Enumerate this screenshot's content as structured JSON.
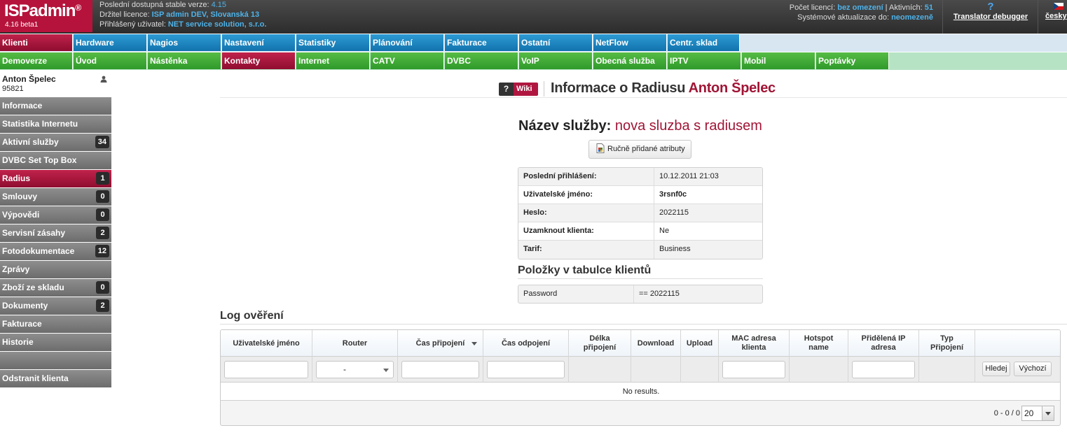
{
  "app": {
    "logo": "ISPadmin",
    "logo_reg": "®",
    "version": "4.16 beta1"
  },
  "topinfo": {
    "stable_label": "Poslední dostupná stable verze:",
    "stable_value": "4.15",
    "holder_label": "Držitel licence:",
    "holder_value": "ISP admin DEV, Slovanská 13",
    "user_label": "Přihlášený uživatel:",
    "user_value": "NET service solution, s.r.o."
  },
  "license": {
    "count_label": "Počet licencí:",
    "count_value": "bez omezení",
    "active_label": "Aktivních:",
    "active_value": "51",
    "updates_label": "Systémové aktualizace do:",
    "updates_value": "neomezeně"
  },
  "debugger": {
    "icon": "?",
    "label": "Translator debugger"
  },
  "language": {
    "label": "česky"
  },
  "menu1": [
    {
      "label": "Klienti",
      "active": true
    },
    {
      "label": "Hardware"
    },
    {
      "label": "Nagios"
    },
    {
      "label": "Nastavení"
    },
    {
      "label": "Statistiky"
    },
    {
      "label": "Plánování"
    },
    {
      "label": "Fakturace"
    },
    {
      "label": "Ostatní"
    },
    {
      "label": "NetFlow"
    },
    {
      "label": "Centr. sklad"
    }
  ],
  "menu2": [
    {
      "label": "Demoverze"
    },
    {
      "label": "Úvod"
    },
    {
      "label": "Nástěnka"
    },
    {
      "label": "Kontakty",
      "active": true
    },
    {
      "label": "Internet"
    },
    {
      "label": "CATV"
    },
    {
      "label": "DVBC"
    },
    {
      "label": "VoIP"
    },
    {
      "label": "Obecná služba"
    },
    {
      "label": "IPTV"
    },
    {
      "label": "Mobil"
    },
    {
      "label": "Poptávky"
    }
  ],
  "client": {
    "name": "Anton Špelec",
    "id": "95821"
  },
  "sidebar": [
    {
      "label": "Informace"
    },
    {
      "label": "Statistika Internetu"
    },
    {
      "label": "Aktivní služby",
      "badge": "34"
    },
    {
      "label": "DVBC Set Top Box"
    },
    {
      "label": "Radius",
      "badge": "1",
      "active": true
    },
    {
      "label": "Smlouvy",
      "badge": "0"
    },
    {
      "label": "Výpovědi",
      "badge": "0"
    },
    {
      "label": "Servisní zásahy",
      "badge": "2"
    },
    {
      "label": "Fotodokumentace",
      "badge": "12"
    },
    {
      "label": "Zprávy"
    },
    {
      "label": "Zboží ze skladu",
      "badge": "0"
    },
    {
      "label": "Dokumenty",
      "badge": "2"
    },
    {
      "label": "Fakturace"
    },
    {
      "label": "Historie"
    },
    {
      "label": ""
    },
    {
      "label": "Odstranit klienta"
    }
  ],
  "page": {
    "wiki_q": "?",
    "wiki_label": "Wiki",
    "title_prefix": "Informace o Radiusu",
    "title_client": "Anton Špelec",
    "service_label": "Název služby:",
    "service_value": "nova sluzba s radiusem",
    "attr_button": "Ručně přidané atributy"
  },
  "details": [
    {
      "key": "Poslední přihlášení:",
      "value": "10.12.2011 21:03"
    },
    {
      "key": "Uživatelské jméno:",
      "value": "3rsnf0c",
      "bold": true
    },
    {
      "key": "Heslo:",
      "value": "2022115"
    },
    {
      "key": "Uzamknout klienta:",
      "value": "Ne"
    },
    {
      "key": "Tarif:",
      "value": "Business"
    }
  ],
  "client_table": {
    "title": "Položky v tabulce klientů",
    "rows": [
      {
        "key": "Password",
        "value": "== 2022115"
      }
    ]
  },
  "log": {
    "title": "Log ověření",
    "columns": [
      "Uživatelské jméno",
      "Router",
      "Čas připojení",
      "Čas odpojení",
      "Délka připojení",
      "Download",
      "Upload",
      "MAC adresa klienta",
      "Hotspot name",
      "Přidělená IP adresa",
      "Typ Připojení",
      ""
    ],
    "router_filter": "-",
    "search_button": "Hledej",
    "default_button": "Výchozí",
    "no_results": "No results.",
    "pager_range": "0 - 0 / 0",
    "page_size": "20"
  }
}
